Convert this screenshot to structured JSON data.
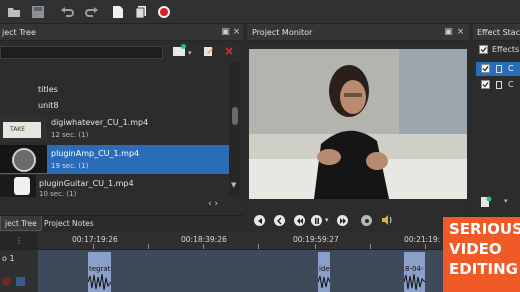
{
  "toolbar": {
    "icons": [
      "folder-icon",
      "save-icon",
      "undo-icon",
      "redo-icon",
      "new-document-icon",
      "copy-icon",
      "record-icon"
    ]
  },
  "project_tree": {
    "title": "ject Tree",
    "search": {
      "value": "",
      "placeholder": ""
    },
    "folders": [
      {
        "label": "titles"
      },
      {
        "label": "unit8"
      }
    ],
    "clips": [
      {
        "name": "digiwhatever_CU_1.mp4",
        "duration": "12 sec. (1)",
        "selected": false,
        "thumb_text": "TAKE"
      },
      {
        "name": "pluginAmp_CU_1.mp4",
        "duration": "19 sec. (1)",
        "selected": true,
        "thumb_text": ""
      },
      {
        "name": "pluginGuitar_CU_1.mp4",
        "duration": "10 sec. (1)",
        "selected": false,
        "thumb_text": ""
      }
    ],
    "tabs": [
      "ject Tree",
      "Project Notes"
    ]
  },
  "project_monitor": {
    "title": "Project Monitor"
  },
  "effect_stack": {
    "title": "Effect Stac",
    "header_label": "Effects",
    "rows": [
      "C",
      "C"
    ]
  },
  "timeline": {
    "timecodes": [
      "00:17:19:26",
      "00:18:39:26",
      "00:19:59:27",
      "00:21:19:"
    ],
    "track_label": "o 1",
    "clips": [
      {
        "label": "tegrat"
      },
      {
        "label": "ide"
      },
      {
        "label": "8-04-"
      }
    ]
  },
  "watermark": {
    "lines": [
      "SERIOUS",
      "VIDEO",
      "EDITING"
    ],
    "color": "#ef5a27"
  },
  "colors": {
    "selection": "#2b6cb8",
    "record": "#d42020",
    "accent_green": "#29c46e"
  }
}
